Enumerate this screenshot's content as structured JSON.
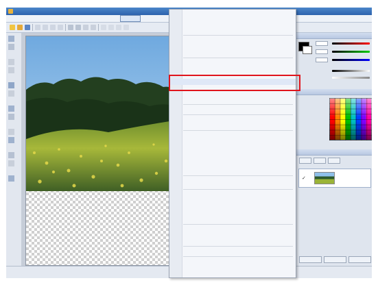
{
  "window": {
    "title": ""
  },
  "menubar": {
    "items": [
      "",
      "",
      "",
      "",
      "",
      "",
      ""
    ]
  },
  "status": {
    "text": ""
  },
  "dropdown": {
    "items": [
      {
        "label": "",
        "shortcut": "",
        "kind": "normal"
      },
      {
        "label": "",
        "shortcut": "",
        "kind": "normal"
      },
      {
        "label": "",
        "shortcut": "",
        "kind": "normal"
      },
      {
        "label": "",
        "shortcut": "",
        "kind": "normal"
      },
      {
        "label": "",
        "shortcut": "",
        "kind": "normal"
      },
      {
        "label": "",
        "shortcut": "",
        "kind": "normal"
      },
      {
        "label": "",
        "shortcut": "",
        "kind": "normal"
      },
      {
        "label": "",
        "shortcut": "",
        "kind": "highlighted"
      },
      {
        "label": "",
        "shortcut": "",
        "kind": "disabled"
      },
      {
        "label": "",
        "shortcut": "",
        "kind": "disabled"
      },
      {
        "label": "",
        "shortcut": "",
        "kind": "normal"
      },
      {
        "label": "",
        "shortcut": "",
        "kind": "normal"
      },
      {
        "label": "",
        "shortcut": "",
        "kind": "normal"
      },
      {
        "label": "",
        "shortcut": "",
        "kind": "disabled"
      },
      {
        "label": "",
        "shortcut": "",
        "kind": "disabled"
      },
      {
        "label": "",
        "shortcut": "",
        "kind": "disabled"
      },
      {
        "label": "",
        "shortcut": "",
        "kind": "disabled"
      },
      {
        "label": "",
        "shortcut": "",
        "kind": "disabled"
      },
      {
        "label": "",
        "shortcut": "",
        "kind": "normal"
      },
      {
        "label": "",
        "shortcut": "",
        "kind": "disabled"
      },
      {
        "label": "",
        "shortcut": "",
        "kind": "normal"
      },
      {
        "label": "",
        "shortcut": "",
        "kind": "normal"
      },
      {
        "label": "",
        "shortcut": "",
        "kind": "normal"
      },
      {
        "label": "",
        "shortcut": "",
        "kind": "normal"
      },
      {
        "label": "",
        "shortcut": "",
        "kind": "normal"
      },
      {
        "label": "",
        "shortcut": "",
        "kind": "normal"
      },
      {
        "label": "",
        "shortcut": "",
        "kind": "normal"
      },
      {
        "label": "",
        "shortcut": "",
        "kind": "normal"
      },
      {
        "label": "",
        "shortcut": "",
        "kind": "normal"
      },
      {
        "label": "",
        "shortcut": "",
        "kind": "normal"
      }
    ]
  },
  "annotation": {
    "color": "#e0141c"
  },
  "colors": {
    "titlebar": "#2d62ad",
    "menu_hover": "#dfe8f7",
    "foreground_swatch": "#000000"
  }
}
